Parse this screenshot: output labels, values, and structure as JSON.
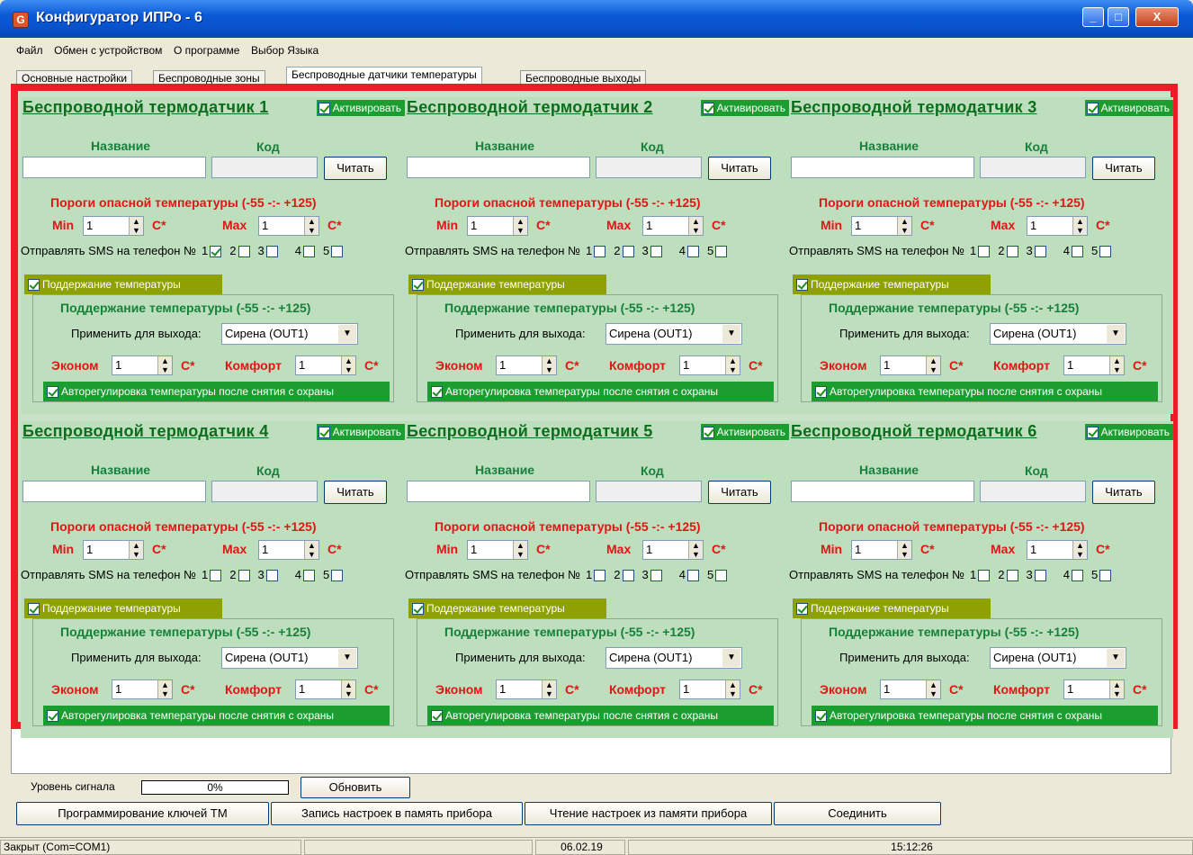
{
  "window": {
    "title": "Конфигуратор ИПРо - 6",
    "icon": "app-shield-icon",
    "controls": [
      "minimize-icon",
      "maximize-icon",
      "close-icon"
    ]
  },
  "menu": [
    "Файл",
    "Обмен с устройством",
    "О программе",
    "Выбор Языка"
  ],
  "tabs": [
    "Основные настройки",
    "Беспроводные зоны",
    "Беспроводные датчики температуры",
    "Беспроводные выходы"
  ],
  "active_tab": 2,
  "sensors": [
    {
      "title": "Беспроводной термодатчик 1",
      "activate": "Активировать",
      "name_label": "Название",
      "code_label": "Код",
      "read_button": "Читать",
      "threshold_label": "Пороги опасной температуры (-55 -:- +125)",
      "min_label": "Min",
      "min_value": "1",
      "max_label": "Max",
      "max_value": "1",
      "unit": "С*",
      "sms_label": "Отправлять SMS на телефон №",
      "sms": [
        {
          "n": "1",
          "checked": true
        },
        {
          "n": "2",
          "checked": false
        },
        {
          "n": "3",
          "checked": false
        },
        {
          "n": "4",
          "checked": false
        },
        {
          "n": "5",
          "checked": false
        }
      ],
      "maint_check": "Поддержание температуры",
      "maint_title": "Поддержание температуры (-55 -:- +125)",
      "apply_label": "Применить для выхода:",
      "output": "Сирена (OUT1)",
      "econom_label": "Эконом",
      "econom_value": "1",
      "comfort_label": "Комфорт",
      "comfort_value": "1",
      "auto_label": "Авторегулировка температуры после снятия с охраны"
    },
    {
      "title": "Беспроводной термодатчик 2",
      "activate": "Активировать",
      "name_label": "Название",
      "code_label": "Код",
      "read_button": "Читать",
      "threshold_label": "Пороги опасной температуры (-55 -:- +125)",
      "min_label": "Min",
      "min_value": "1",
      "max_label": "Max",
      "max_value": "1",
      "unit": "С*",
      "sms_label": "Отправлять SMS на телефон №",
      "sms": [
        {
          "n": "1",
          "checked": false
        },
        {
          "n": "2",
          "checked": false
        },
        {
          "n": "3",
          "checked": false
        },
        {
          "n": "4",
          "checked": false
        },
        {
          "n": "5",
          "checked": false
        }
      ],
      "maint_check": "Поддержание температуры",
      "maint_title": "Поддержание температуры (-55 -:- +125)",
      "apply_label": "Применить для выхода:",
      "output": "Сирена (OUT1)",
      "econom_label": "Эконом",
      "econom_value": "1",
      "comfort_label": "Комфорт",
      "comfort_value": "1",
      "auto_label": "Авторегулировка температуры после снятия с охраны"
    },
    {
      "title": "Беспроводной термодатчик 3",
      "activate": "Активировать",
      "name_label": "Название",
      "code_label": "Код",
      "read_button": "Читать",
      "threshold_label": "Пороги опасной температуры (-55 -:- +125)",
      "min_label": "Min",
      "min_value": "1",
      "max_label": "Max",
      "max_value": "1",
      "unit": "С*",
      "sms_label": "Отправлять SMS на телефон №",
      "sms": [
        {
          "n": "1",
          "checked": false
        },
        {
          "n": "2",
          "checked": false
        },
        {
          "n": "3",
          "checked": false
        },
        {
          "n": "4",
          "checked": false
        },
        {
          "n": "5",
          "checked": false
        }
      ],
      "maint_check": "Поддержание температуры",
      "maint_title": "Поддержание температуры (-55 -:- +125)",
      "apply_label": "Применить для выхода:",
      "output": "Сирена (OUT1)",
      "econom_label": "Эконом",
      "econom_value": "1",
      "comfort_label": "Комфорт",
      "comfort_value": "1",
      "auto_label": "Авторегулировка температуры после снятия с охраны"
    },
    {
      "title": "Беспроводной термодатчик 4",
      "activate": "Активировать",
      "name_label": "Название",
      "code_label": "Код",
      "read_button": "Читать",
      "threshold_label": "Пороги опасной температуры (-55 -:- +125)",
      "min_label": "Min",
      "min_value": "1",
      "max_label": "Max",
      "max_value": "1",
      "unit": "С*",
      "sms_label": "Отправлять SMS на телефон №",
      "sms": [
        {
          "n": "1",
          "checked": false
        },
        {
          "n": "2",
          "checked": false
        },
        {
          "n": "3",
          "checked": false
        },
        {
          "n": "4",
          "checked": false
        },
        {
          "n": "5",
          "checked": false
        }
      ],
      "maint_check": "Поддержание температуры",
      "maint_title": "Поддержание температуры (-55 -:- +125)",
      "apply_label": "Применить для выхода:",
      "output": "Сирена (OUT1)",
      "econom_label": "Эконом",
      "econom_value": "1",
      "comfort_label": "Комфорт",
      "comfort_value": "1",
      "auto_label": "Авторегулировка температуры после снятия с охраны"
    },
    {
      "title": "Беспроводной термодатчик 5",
      "activate": "Активировать",
      "name_label": "Название",
      "code_label": "Код",
      "read_button": "Читать",
      "threshold_label": "Пороги опасной температуры (-55 -:- +125)",
      "min_label": "Min",
      "min_value": "1",
      "max_label": "Max",
      "max_value": "1",
      "unit": "С*",
      "sms_label": "Отправлять SMS на телефон №",
      "sms": [
        {
          "n": "1",
          "checked": false
        },
        {
          "n": "2",
          "checked": false
        },
        {
          "n": "3",
          "checked": false
        },
        {
          "n": "4",
          "checked": false
        },
        {
          "n": "5",
          "checked": false
        }
      ],
      "maint_check": "Поддержание температуры",
      "maint_title": "Поддержание температуры (-55 -:- +125)",
      "apply_label": "Применить для выхода:",
      "output": "Сирена (OUT1)",
      "econom_label": "Эконом",
      "econom_value": "1",
      "comfort_label": "Комфорт",
      "comfort_value": "1",
      "auto_label": "Авторегулировка температуры после снятия с охраны"
    },
    {
      "title": "Беспроводной термодатчик 6",
      "activate": "Активировать",
      "name_label": "Название",
      "code_label": "Код",
      "read_button": "Читать",
      "threshold_label": "Пороги опасной температуры (-55 -:- +125)",
      "min_label": "Min",
      "min_value": "1",
      "max_label": "Max",
      "max_value": "1",
      "unit": "С*",
      "sms_label": "Отправлять SMS на телефон №",
      "sms": [
        {
          "n": "1",
          "checked": false
        },
        {
          "n": "2",
          "checked": false
        },
        {
          "n": "3",
          "checked": false
        },
        {
          "n": "4",
          "checked": false
        },
        {
          "n": "5",
          "checked": false
        }
      ],
      "maint_check": "Поддержание температуры",
      "maint_title": "Поддержание температуры (-55 -:- +125)",
      "apply_label": "Применить для выхода:",
      "output": "Сирена (OUT1)",
      "econom_label": "Эконом",
      "econom_value": "1",
      "comfort_label": "Комфорт",
      "comfort_value": "1",
      "auto_label": "Авторегулировка температуры после снятия с охраны"
    }
  ],
  "signal": {
    "label": "Уровень сигнала",
    "value": "0%",
    "refresh": "Обновить"
  },
  "bottom_buttons": [
    "Программирование ключей ТМ",
    "Запись настроек в память прибора",
    "Чтение настроек из памяти прибора",
    "Соединить"
  ],
  "statusbar": {
    "port": "Закрыт (Com=COM1)",
    "date": "06.02.19",
    "time": "15:12:26"
  },
  "colors": {
    "highlight_frame": "#ee1c24",
    "panel": "#bedfbe",
    "activate_green": "#1b9e2f",
    "maint_olive": "#8ea100",
    "title_green": "#0a6e1c"
  }
}
